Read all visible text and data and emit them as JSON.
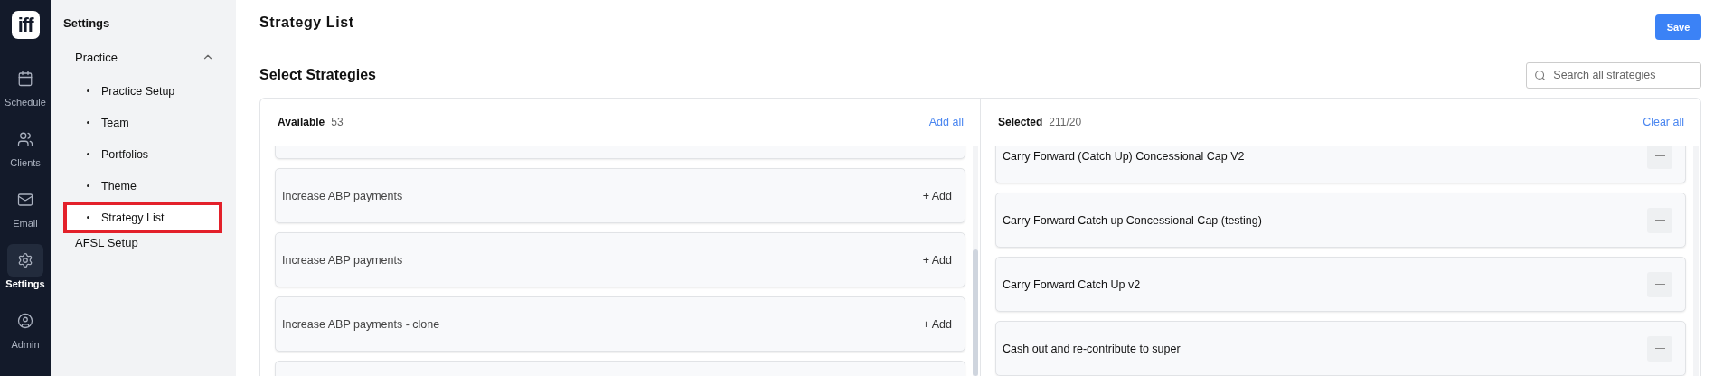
{
  "rail": {
    "logo": "iff",
    "items": [
      {
        "label": "Schedule",
        "selected": false
      },
      {
        "label": "Clients",
        "selected": false
      },
      {
        "label": "Email",
        "selected": false
      },
      {
        "label": "Settings",
        "selected": true
      },
      {
        "label": "Admin",
        "selected": false
      }
    ]
  },
  "sidebar": {
    "title": "Settings",
    "groups": [
      {
        "label": "Practice",
        "expanded": true,
        "children": [
          {
            "label": "Practice Setup",
            "selected": false
          },
          {
            "label": "Team",
            "selected": false
          },
          {
            "label": "Portfolios",
            "selected": false
          },
          {
            "label": "Theme",
            "selected": false
          },
          {
            "label": "Strategy List",
            "selected": true
          }
        ]
      },
      {
        "label": "AFSL Setup",
        "expanded": false
      }
    ]
  },
  "page": {
    "title": "Strategy List",
    "save": "Save",
    "subtitle": "Select Strategies",
    "search": {
      "placeholder": "Search all strategies"
    }
  },
  "available": {
    "label": "Available",
    "count": "53",
    "action": "Add all",
    "items": [
      {
        "kind": "clipped"
      },
      {
        "kind": "strategy",
        "label": "Increase ABP payments",
        "add": "+ Add"
      },
      {
        "kind": "strategy",
        "label": "Increase ABP payments",
        "add": "+ Add"
      },
      {
        "kind": "strategy",
        "label": "Increase ABP payments - clone",
        "add": "+ Add"
      },
      {
        "kind": "clipped"
      }
    ]
  },
  "selected": {
    "label": "Selected",
    "count": "211/20",
    "action": "Clear all",
    "items": [
      {
        "label": "Carry Forward (Catch Up) Concessional Cap V2"
      },
      {
        "label": "Carry Forward Catch up Concessional Cap (testing)"
      },
      {
        "label": "Carry Forward Catch Up v2"
      },
      {
        "label": "Cash out and re-contribute to super"
      }
    ]
  }
}
